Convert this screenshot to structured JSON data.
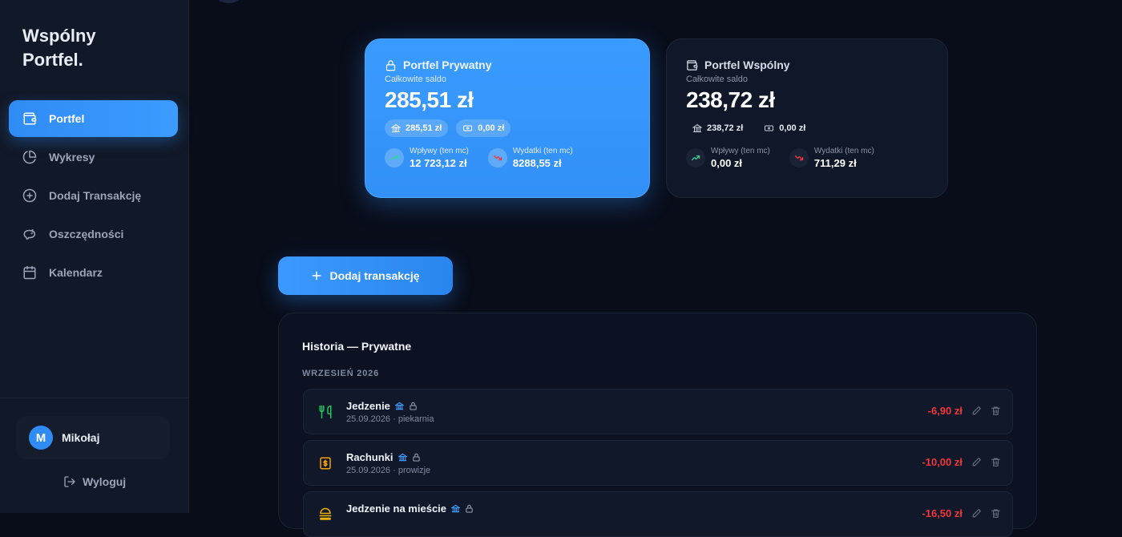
{
  "brand": {
    "line1": "Wspólny",
    "line2": "Portfel."
  },
  "nav": [
    {
      "label": "Portfel",
      "icon": "wallet-icon",
      "active": true
    },
    {
      "label": "Wykresy",
      "icon": "pie-chart-icon"
    },
    {
      "label": "Dodaj Transakcję",
      "icon": "plus-circle-icon"
    },
    {
      "label": "Oszczędności",
      "icon": "piggy-bank-icon"
    },
    {
      "label": "Kalendarz",
      "icon": "calendar-icon"
    }
  ],
  "user": {
    "initial": "M",
    "name": "Mikołaj"
  },
  "logout_label": "Wyloguj",
  "cards": {
    "private": {
      "title": "Portfel Prywatny",
      "subtitle": "Całkowite saldo",
      "total": "285,51 zł",
      "bank": "285,51 zł",
      "cash": "0,00 zł",
      "income_label": "Wpływy (ten mc)",
      "income": "12 723,12 zł",
      "expense_label": "Wydatki (ten mc)",
      "expense": "8288,55 zł"
    },
    "shared": {
      "title": "Portfel Wspólny",
      "subtitle": "Całkowite saldo",
      "total": "238,72 zł",
      "bank": "238,72 zł",
      "cash": "0,00 zł",
      "income_label": "Wpływy (ten mc)",
      "income": "0,00 zł",
      "expense_label": "Wydatki (ten mc)",
      "expense": "711,29 zł"
    }
  },
  "add_transaction_label": "Dodaj transakcję",
  "history": {
    "title": "Historia — Prywatne",
    "month": "WRZESIEŃ 2026",
    "transactions": [
      {
        "name": "Jedzenie",
        "meta": "25.09.2026 · piekarnia",
        "amount": "-6,90 zł",
        "icon": "utensils-icon",
        "color": "#22c55e"
      },
      {
        "name": "Rachunki",
        "meta": "25.09.2026 · prowizje",
        "amount": "-10,00 zł",
        "icon": "bill-icon",
        "color": "#f59e0b"
      },
      {
        "name": "Jedzenie na mieście",
        "meta": "",
        "amount": "-16,50 zł",
        "icon": "fastfood-icon",
        "color": "#eab308"
      }
    ]
  },
  "colors": {
    "accent": "#3290f7",
    "negative": "#f0383b",
    "background": "#090d1a"
  }
}
